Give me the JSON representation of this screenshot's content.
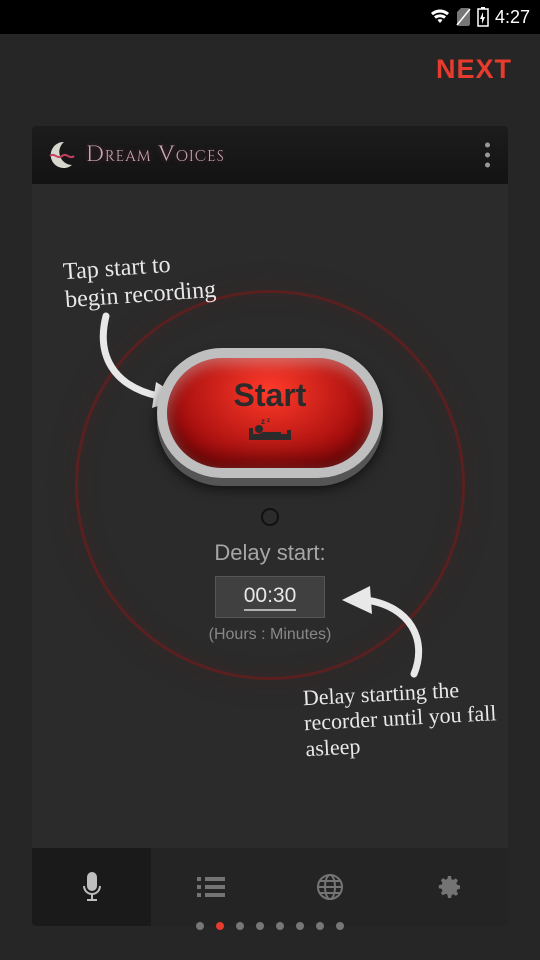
{
  "statusbar": {
    "time": "4:27"
  },
  "onboarding": {
    "next_label": "NEXT"
  },
  "app": {
    "title": "Dream Voices",
    "hint_start": "Tap start to\nbegin recording",
    "hint_delay": "Delay starting the recorder until you fall asleep",
    "start_label": "Start",
    "delay_label": "Delay start:",
    "delay_value": "00:30",
    "delay_format_hint": "(Hours : Minutes)"
  },
  "nav": {
    "items": [
      "record",
      "list",
      "web",
      "settings"
    ],
    "active_index": 0
  },
  "pager": {
    "total": 8,
    "active_index": 1
  },
  "colors": {
    "accent": "#e73b2d",
    "ring": "#5a2020"
  }
}
